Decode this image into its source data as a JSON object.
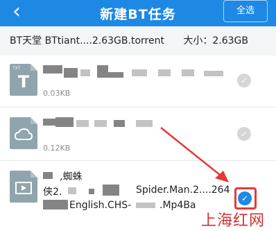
{
  "header": {
    "back_icon": "chevron-left-icon",
    "title": "新建BT任务",
    "select_all_label": "全选",
    "bg_color": "#1e88e5"
  },
  "torrent": {
    "name": "BT天堂 BTtiant....2.63GB.torrent",
    "size": "大小：2.63GB"
  },
  "files": [
    {
      "icon": "text-file-icon",
      "icon_tag": "TXT",
      "icon_glyph": "T",
      "size": "0.03KB",
      "checked": false
    },
    {
      "icon": "cloud-file-icon",
      "size": "0.12KB",
      "checked": false
    },
    {
      "icon": "video-file-icon",
      "name_line1": ",蜘蛛",
      "name_line2_start": "侠2.",
      "name_line2_mid": "Spider.Man.2....264",
      "name_line3_mid": "English.CHS-",
      "name_line3_end": ".Mp4Ba",
      "checked": true
    }
  ],
  "watermark": "上海红网",
  "colors": {
    "accent": "#1e88e5",
    "annotation": "#e53935"
  }
}
